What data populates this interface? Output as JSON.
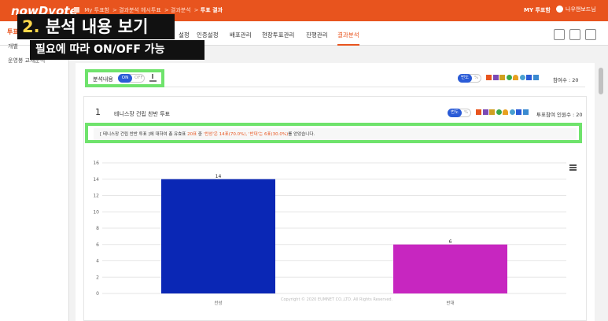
{
  "header": {
    "logo": "nowDvote",
    "breadcrumb": [
      "My 투표함",
      "결과분석 헤시투표",
      "결과분석",
      "투표 결과"
    ],
    "my_vote": "MY 투표함",
    "user": "나우앤보드님",
    "brand_color": "#e8541e"
  },
  "subnav": {
    "title": "투표",
    "tabs": [
      "설정",
      "인증설정",
      "배포관리",
      "현장투표관리",
      "진행관리",
      "결과분석"
    ],
    "active_tab": "결과분석",
    "tool_icons": [
      "download-icon",
      "filter-icon",
      "share-icon"
    ]
  },
  "sidebar": {
    "items": [
      "개별",
      "운영봉 교재분석"
    ]
  },
  "annotation": {
    "title_num": "2.",
    "title": "분석 내용 보기",
    "subtitle": "필요에 따라 ON/OFF 가능"
  },
  "options": {
    "label": "분석내용",
    "toggle_on": "ON",
    "toggle_off": "OFF",
    "pill_on": "번도",
    "pill_pct": "%",
    "participants": "참여수 : 20"
  },
  "question": {
    "number": "1",
    "title": "테니스장 건립 찬반 투표",
    "pill_on": "번도",
    "pill_pct": "%",
    "participants": "투표참여 인원수 : 20",
    "analysis_prefix": "[ 테니스장 건립 찬반 투표 ]에 대하여 총 유효표",
    "analysis_total": "20표",
    "analysis_mid": " 중 ",
    "analysis_result": "'찬성'은 14표(70.0%), '반대'는 6표(30.0%)",
    "analysis_suffix": "를 얻었습니다."
  },
  "footer": {
    "copyright": "Copyright © 2020 EUMNET CO.,LTD. All Rights Reserved."
  },
  "chart_data": {
    "type": "bar",
    "categories": [
      "찬성",
      "반대"
    ],
    "values": [
      14,
      6
    ],
    "colors": [
      "#0a27b5",
      "#c726c0"
    ],
    "ylim": [
      0,
      16
    ],
    "yticks": [
      0,
      2,
      4,
      6,
      8,
      10,
      12,
      14,
      16
    ],
    "grid": true
  }
}
